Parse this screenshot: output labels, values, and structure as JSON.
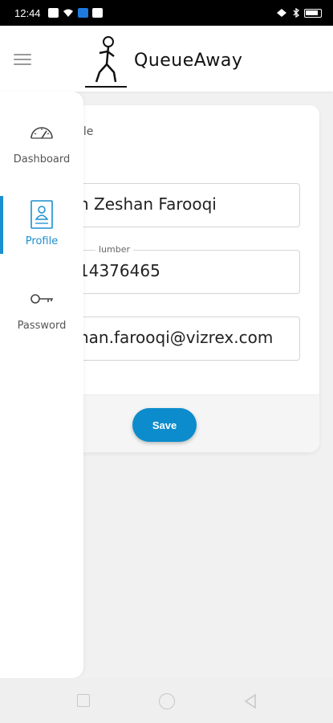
{
  "status_bar": {
    "time": "12:44"
  },
  "header": {
    "brand": "QueueAway"
  },
  "sidebar": {
    "items": [
      {
        "label": "Dashboard",
        "icon": "speedometer-icon"
      },
      {
        "label": "Profile",
        "icon": "profile-card-icon",
        "active": true
      },
      {
        "label": "Password",
        "icon": "key-icon"
      }
    ]
  },
  "profile_card": {
    "title": "ile",
    "name_field": {
      "value": "n Zeshan Farooqi"
    },
    "phone_field": {
      "legend": "lumber",
      "value": "14376465"
    },
    "email_field": {
      "value": "han.farooqi@vizrex.com"
    },
    "save_label": "Save"
  },
  "colors": {
    "accent": "#0c8ccc",
    "active_nav": "#1b8fcf"
  }
}
